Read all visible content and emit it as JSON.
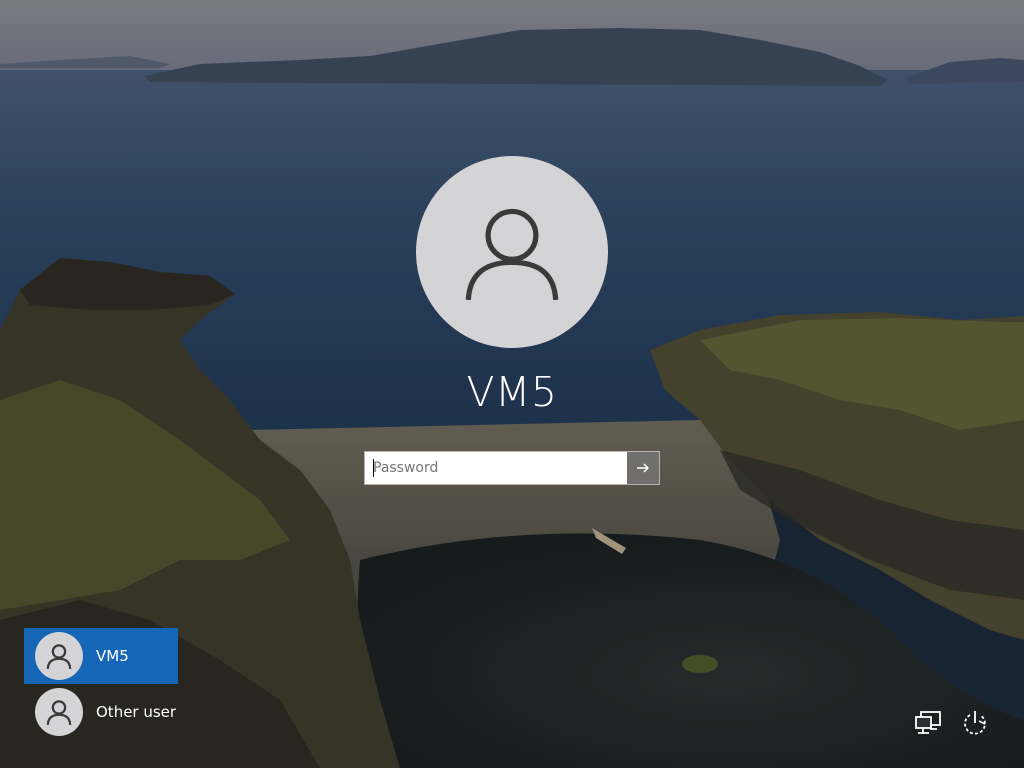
{
  "login": {
    "username": "VM5",
    "password_placeholder": "Password",
    "submit_icon": "arrow-right-icon"
  },
  "user_list": [
    {
      "label": "VM5",
      "selected": true,
      "icon": "user-icon"
    },
    {
      "label": "Other user",
      "selected": false,
      "icon": "user-icon"
    }
  ],
  "system_buttons": {
    "network_icon": "network-icon",
    "power_icon": "power-icon"
  },
  "colors": {
    "accent": "#1566b6",
    "avatar_bg": "#d4d4d6",
    "avatar_glyph": "#3a3a3a"
  }
}
